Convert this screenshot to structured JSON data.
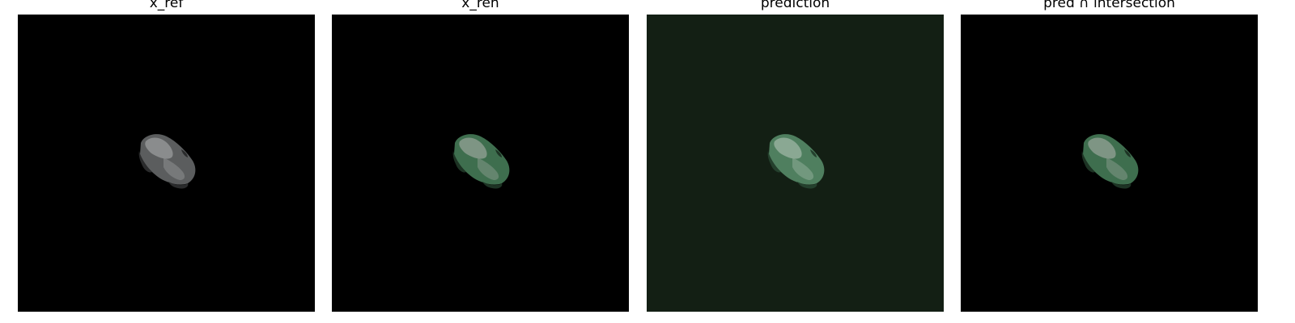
{
  "figure": {
    "panels": [
      {
        "title": "x_ref",
        "background": "#000000",
        "car_body": "#5b5d5e",
        "car_highlight": "#8a8c8d",
        "car_dark": "#2a2b2c"
      },
      {
        "title": "x_ren",
        "background": "#000000",
        "car_body": "#3e6e4e",
        "car_highlight": "#7e9584",
        "car_dark": "#1d3324"
      },
      {
        "title": "prediction",
        "background": "#131f14",
        "car_body": "#4f7f5f",
        "car_highlight": "#8aa893",
        "car_dark": "#24402d"
      },
      {
        "title": "pred ∩ intersection",
        "background": "#000000",
        "car_body": "#3e6e4e",
        "car_highlight": "#7e9584",
        "car_dark": "#1d3324"
      }
    ]
  }
}
